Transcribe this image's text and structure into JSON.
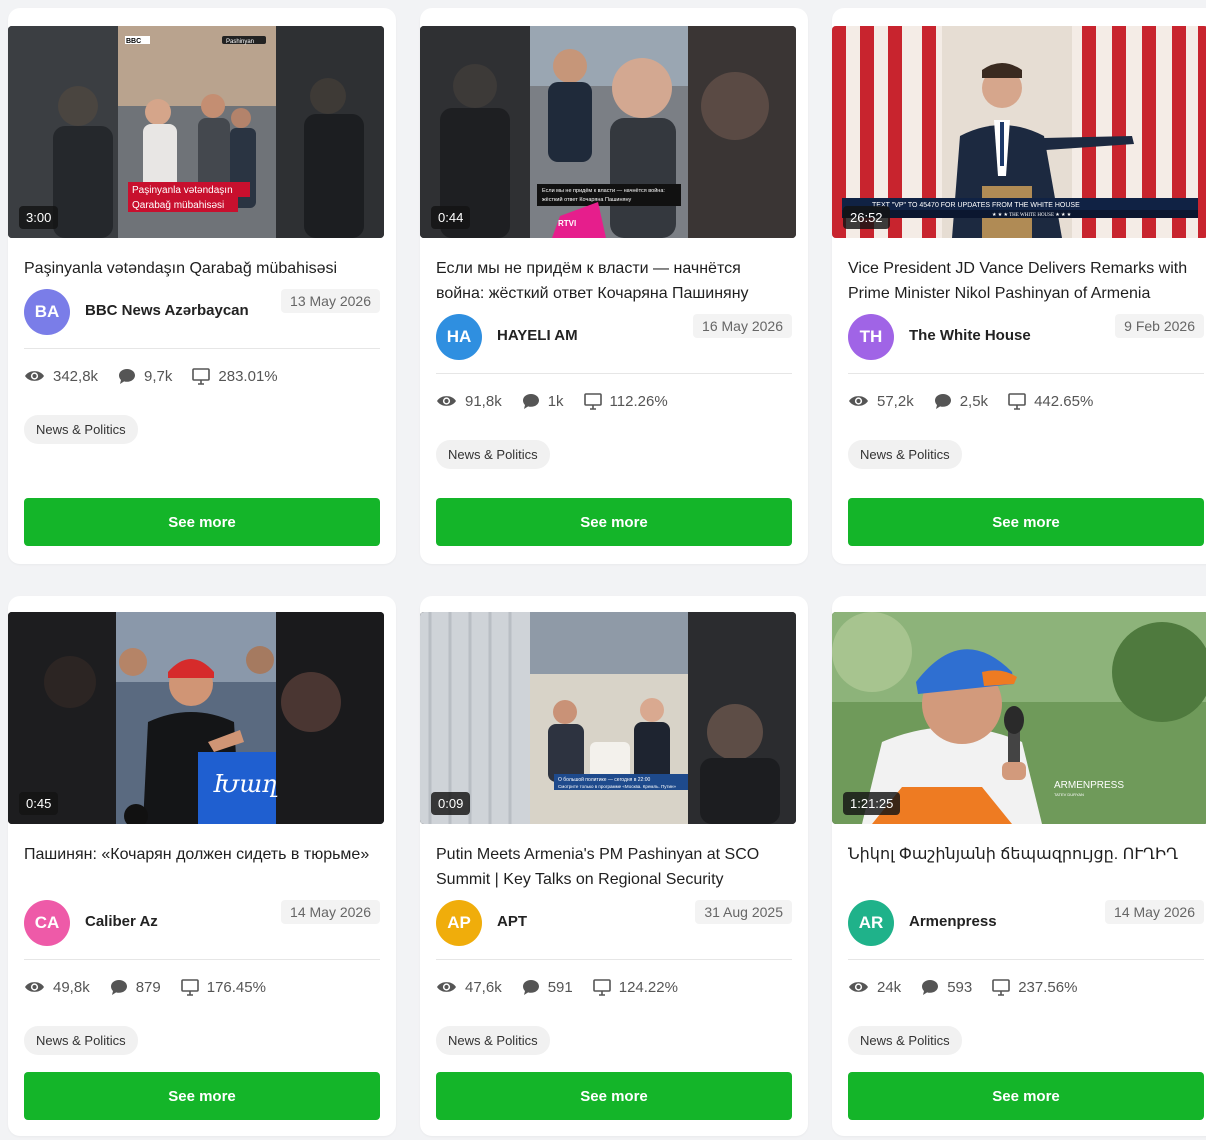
{
  "cards": [
    {
      "duration": "3:00",
      "title": "Paşinyanla vətəndaşın Qarabağ mübahisəsi",
      "avatar": "BA",
      "avatar_color": "#7a7de8",
      "channel": "BBC News Azərbaycan",
      "date": "13 May 2026",
      "views": "342,8k",
      "comments": "9,7k",
      "ratio": "283.01%",
      "tag": "News & Politics",
      "button": "See more",
      "thumb_caption_line1": "Paşinyanla vətəndaşın",
      "thumb_caption_line2": "Qarabağ mübahisəsi",
      "thumb_logo": "BBC",
      "thumb_handle": "Pashinyan"
    },
    {
      "duration": "0:44",
      "title": "Если мы не придём к власти — начнётся война: жёсткий ответ Кочаряна Пашиняну",
      "avatar": "HA",
      "avatar_color": "#2f8fe0",
      "channel": "HAYELI AM",
      "date": "16 May 2026",
      "views": "91,8k",
      "comments": "1k",
      "ratio": "112.26%",
      "tag": "News & Politics",
      "button": "See more",
      "thumb_caption_line1": "Если мы не придём к власти — начнётся война:",
      "thumb_caption_line2": "жёсткий ответ Кочаряна Пашиняну",
      "thumb_logo": "RTVI"
    },
    {
      "duration": "26:52",
      "title": "Vice President JD Vance Delivers Remarks with Prime Minister Nikol Pashinyan of Armenia",
      "avatar": "TH",
      "avatar_color": "#a064e6",
      "channel": "The White House",
      "date": "9 Feb 2026",
      "views": "57,2k",
      "comments": "2,5k",
      "ratio": "442.65%",
      "tag": "News & Politics",
      "button": "See more",
      "thumb_ticker": "TEXT \"VP\" TO 45470 FOR UPDATES FROM THE WHITE HOUSE",
      "thumb_logo": "★ ★ ★  THE WHITE HOUSE  ★ ★ ★"
    },
    {
      "duration": "0:45",
      "title": "Пашинян: «Кочарян должен сидеть в тюрьме»",
      "avatar": "CA",
      "avatar_color": "#ee5aa8",
      "channel": "Caliber Az",
      "date": "14 May 2026",
      "views": "49,8k",
      "comments": "879",
      "ratio": "176.45%",
      "tag": "News & Politics",
      "button": "See more",
      "thumb_logo": "Խաղ"
    },
    {
      "duration": "0:09",
      "title": "Putin Meets Armenia's PM Pashinyan at SCO Summit | Key Talks on Regional Security",
      "avatar": "AP",
      "avatar_color": "#f0ad0b",
      "channel": "APT",
      "date": "31 Aug 2025",
      "views": "47,6k",
      "comments": "591",
      "ratio": "124.22%",
      "tag": "News & Politics",
      "button": "See more",
      "thumb_caption_line1": "О большой политике — сегодня в 22:00",
      "thumb_caption_line2": "Смотрите только в программе «Москва. Кремль. Путин»"
    },
    {
      "duration": "1:21:25",
      "title": "Նիկոլ Փաշինյանի ճեպազրույցը. ՈՒՂԻՂ",
      "avatar": "AR",
      "avatar_color": "#1fb28a",
      "channel": "Armenpress",
      "date": "14 May 2026",
      "views": "24k",
      "comments": "593",
      "ratio": "237.56%",
      "tag": "News & Politics",
      "button": "See more",
      "thumb_logo": "ARMENPRESS",
      "thumb_handle": "TATEV DURYAN"
    }
  ]
}
